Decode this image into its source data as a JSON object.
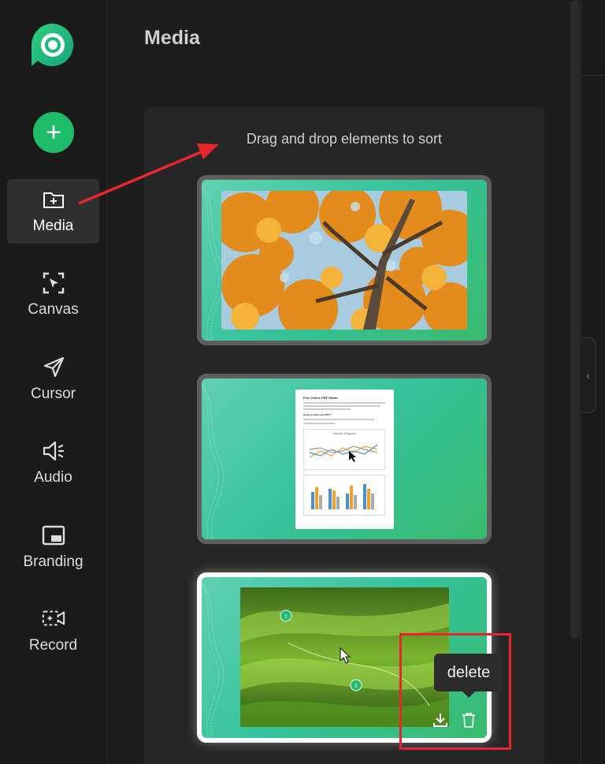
{
  "sidebar": {
    "add_button_label": "+",
    "items": [
      {
        "label": "Media",
        "icon": "folder-plus-icon",
        "active": true
      },
      {
        "label": "Canvas",
        "icon": "canvas-select-icon"
      },
      {
        "label": "Cursor",
        "icon": "cursor-arrow-icon"
      },
      {
        "label": "Audio",
        "icon": "speaker-icon"
      },
      {
        "label": "Branding",
        "icon": "branding-icon"
      },
      {
        "label": "Record",
        "icon": "record-camera-icon"
      }
    ]
  },
  "main": {
    "title": "Media",
    "hint": "Drag and drop elements to sort",
    "thumbnail_doc": {
      "title": "Free Online PDF Editor",
      "heading": "Ready to Edit your PDF?",
      "chart_title": "Sample Diagram"
    },
    "markers": [
      "1",
      "2"
    ]
  },
  "tooltip": {
    "text": "delete"
  },
  "colors": {
    "accent": "#1fbd6b",
    "annotation": "#e5262c",
    "media_background": "#3fc49a"
  }
}
